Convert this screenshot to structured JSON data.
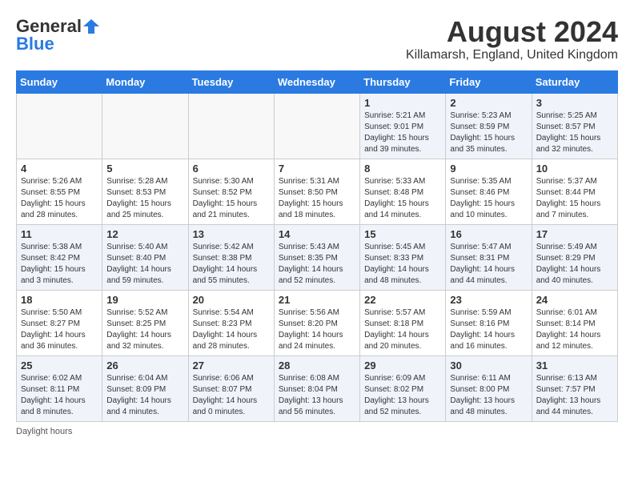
{
  "header": {
    "logo_general": "General",
    "logo_blue": "Blue",
    "main_title": "August 2024",
    "subtitle": "Killamarsh, England, United Kingdom"
  },
  "calendar": {
    "headers": [
      "Sunday",
      "Monday",
      "Tuesday",
      "Wednesday",
      "Thursday",
      "Friday",
      "Saturday"
    ],
    "weeks": [
      [
        {
          "day": "",
          "info": ""
        },
        {
          "day": "",
          "info": ""
        },
        {
          "day": "",
          "info": ""
        },
        {
          "day": "",
          "info": ""
        },
        {
          "day": "1",
          "info": "Sunrise: 5:21 AM\nSunset: 9:01 PM\nDaylight: 15 hours and 39 minutes."
        },
        {
          "day": "2",
          "info": "Sunrise: 5:23 AM\nSunset: 8:59 PM\nDaylight: 15 hours and 35 minutes."
        },
        {
          "day": "3",
          "info": "Sunrise: 5:25 AM\nSunset: 8:57 PM\nDaylight: 15 hours and 32 minutes."
        }
      ],
      [
        {
          "day": "4",
          "info": "Sunrise: 5:26 AM\nSunset: 8:55 PM\nDaylight: 15 hours and 28 minutes."
        },
        {
          "day": "5",
          "info": "Sunrise: 5:28 AM\nSunset: 8:53 PM\nDaylight: 15 hours and 25 minutes."
        },
        {
          "day": "6",
          "info": "Sunrise: 5:30 AM\nSunset: 8:52 PM\nDaylight: 15 hours and 21 minutes."
        },
        {
          "day": "7",
          "info": "Sunrise: 5:31 AM\nSunset: 8:50 PM\nDaylight: 15 hours and 18 minutes."
        },
        {
          "day": "8",
          "info": "Sunrise: 5:33 AM\nSunset: 8:48 PM\nDaylight: 15 hours and 14 minutes."
        },
        {
          "day": "9",
          "info": "Sunrise: 5:35 AM\nSunset: 8:46 PM\nDaylight: 15 hours and 10 minutes."
        },
        {
          "day": "10",
          "info": "Sunrise: 5:37 AM\nSunset: 8:44 PM\nDaylight: 15 hours and 7 minutes."
        }
      ],
      [
        {
          "day": "11",
          "info": "Sunrise: 5:38 AM\nSunset: 8:42 PM\nDaylight: 15 hours and 3 minutes."
        },
        {
          "day": "12",
          "info": "Sunrise: 5:40 AM\nSunset: 8:40 PM\nDaylight: 14 hours and 59 minutes."
        },
        {
          "day": "13",
          "info": "Sunrise: 5:42 AM\nSunset: 8:38 PM\nDaylight: 14 hours and 55 minutes."
        },
        {
          "day": "14",
          "info": "Sunrise: 5:43 AM\nSunset: 8:35 PM\nDaylight: 14 hours and 52 minutes."
        },
        {
          "day": "15",
          "info": "Sunrise: 5:45 AM\nSunset: 8:33 PM\nDaylight: 14 hours and 48 minutes."
        },
        {
          "day": "16",
          "info": "Sunrise: 5:47 AM\nSunset: 8:31 PM\nDaylight: 14 hours and 44 minutes."
        },
        {
          "day": "17",
          "info": "Sunrise: 5:49 AM\nSunset: 8:29 PM\nDaylight: 14 hours and 40 minutes."
        }
      ],
      [
        {
          "day": "18",
          "info": "Sunrise: 5:50 AM\nSunset: 8:27 PM\nDaylight: 14 hours and 36 minutes."
        },
        {
          "day": "19",
          "info": "Sunrise: 5:52 AM\nSunset: 8:25 PM\nDaylight: 14 hours and 32 minutes."
        },
        {
          "day": "20",
          "info": "Sunrise: 5:54 AM\nSunset: 8:23 PM\nDaylight: 14 hours and 28 minutes."
        },
        {
          "day": "21",
          "info": "Sunrise: 5:56 AM\nSunset: 8:20 PM\nDaylight: 14 hours and 24 minutes."
        },
        {
          "day": "22",
          "info": "Sunrise: 5:57 AM\nSunset: 8:18 PM\nDaylight: 14 hours and 20 minutes."
        },
        {
          "day": "23",
          "info": "Sunrise: 5:59 AM\nSunset: 8:16 PM\nDaylight: 14 hours and 16 minutes."
        },
        {
          "day": "24",
          "info": "Sunrise: 6:01 AM\nSunset: 8:14 PM\nDaylight: 14 hours and 12 minutes."
        }
      ],
      [
        {
          "day": "25",
          "info": "Sunrise: 6:02 AM\nSunset: 8:11 PM\nDaylight: 14 hours and 8 minutes."
        },
        {
          "day": "26",
          "info": "Sunrise: 6:04 AM\nSunset: 8:09 PM\nDaylight: 14 hours and 4 minutes."
        },
        {
          "day": "27",
          "info": "Sunrise: 6:06 AM\nSunset: 8:07 PM\nDaylight: 14 hours and 0 minutes."
        },
        {
          "day": "28",
          "info": "Sunrise: 6:08 AM\nSunset: 8:04 PM\nDaylight: 13 hours and 56 minutes."
        },
        {
          "day": "29",
          "info": "Sunrise: 6:09 AM\nSunset: 8:02 PM\nDaylight: 13 hours and 52 minutes."
        },
        {
          "day": "30",
          "info": "Sunrise: 6:11 AM\nSunset: 8:00 PM\nDaylight: 13 hours and 48 minutes."
        },
        {
          "day": "31",
          "info": "Sunrise: 6:13 AM\nSunset: 7:57 PM\nDaylight: 13 hours and 44 minutes."
        }
      ]
    ]
  },
  "footer": {
    "note": "Daylight hours"
  }
}
